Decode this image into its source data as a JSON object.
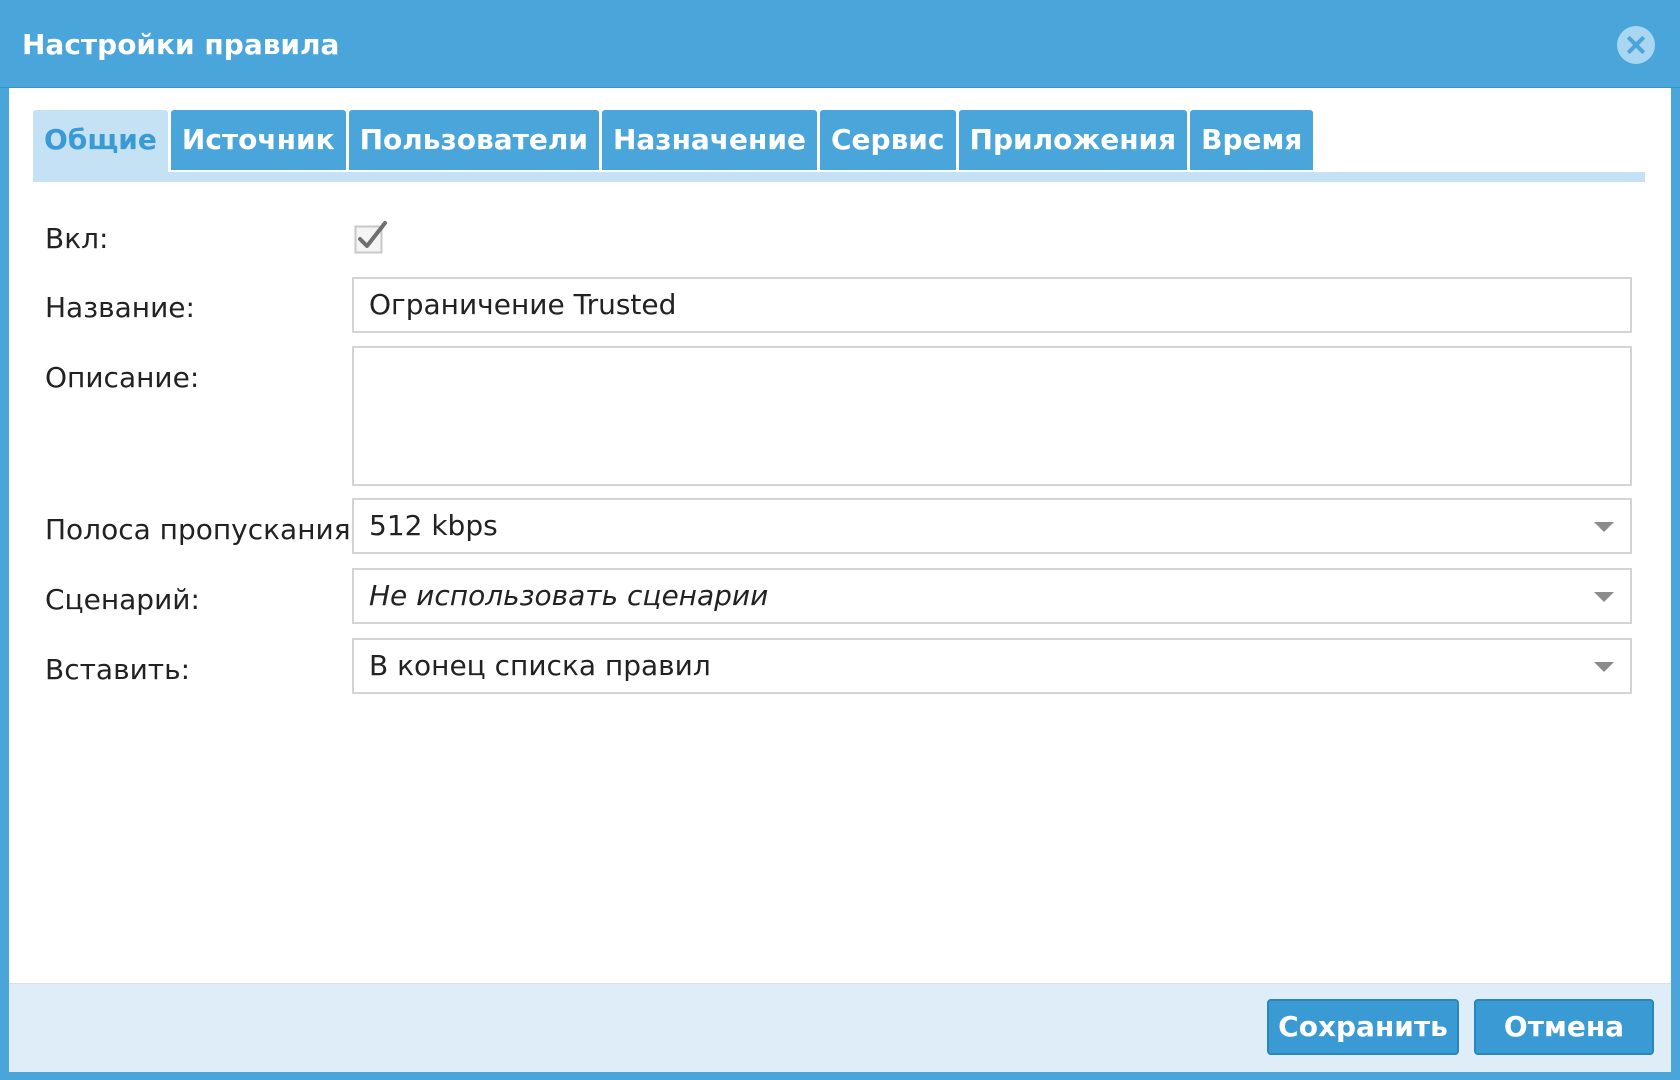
{
  "dialog": {
    "title": "Настройки правила",
    "close_icon": "close-icon"
  },
  "tabs": [
    {
      "label": "Общие",
      "active": true
    },
    {
      "label": "Источник",
      "active": false
    },
    {
      "label": "Пользователи",
      "active": false
    },
    {
      "label": "Назначение",
      "active": false
    },
    {
      "label": "Сервис",
      "active": false
    },
    {
      "label": "Приложения",
      "active": false
    },
    {
      "label": "Время",
      "active": false
    }
  ],
  "form": {
    "enabled": {
      "label": "Вкл:",
      "checked": true
    },
    "name": {
      "label": "Название:",
      "value": "Ограничение Trusted"
    },
    "description": {
      "label": "Описание:",
      "value": ""
    },
    "bandwidth": {
      "label": "Полоса пропускания:",
      "value": "512 kbps"
    },
    "scenario": {
      "label": "Сценарий:",
      "value": "Не использовать сценарии"
    },
    "insert": {
      "label": "Вставить:",
      "value": "В конец списка правил"
    }
  },
  "footer": {
    "save_label": "Сохранить",
    "cancel_label": "Отмена"
  },
  "colors": {
    "header": "#4aa6da",
    "tab_active_bg": "#c5e2f4",
    "tab_active_text": "#3a9ad4",
    "button": "#3a9ad4",
    "footer_bg": "#deedf7"
  }
}
